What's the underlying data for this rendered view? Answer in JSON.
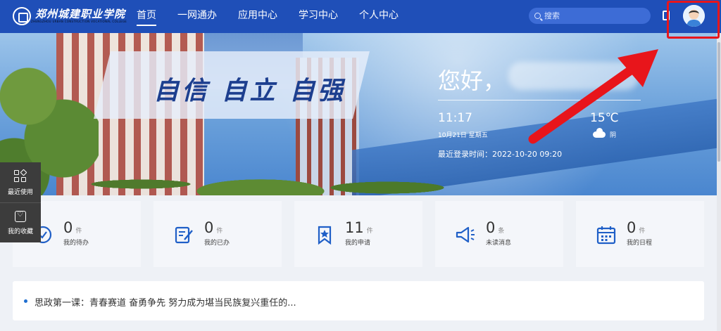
{
  "header": {
    "logo_text": "郑州城建职业学院",
    "logo_sub": "ZHENGZHOU URBAN CONSTRUCTION VOCATIONAL COLLEGE",
    "nav": [
      {
        "label": "首页",
        "active": true
      },
      {
        "label": "一网通办",
        "active": false
      },
      {
        "label": "应用中心",
        "active": false
      },
      {
        "label": "学习中心",
        "active": false
      },
      {
        "label": "个人中心",
        "active": false
      }
    ],
    "search_placeholder": "搜索"
  },
  "hero": {
    "slogan": "自信 自立 自强",
    "greeting": "您好，",
    "time": "11:17",
    "date": "10月21日 星期五",
    "temperature": "15℃",
    "weather": "阴",
    "last_login": "最近登录时间：2022-10-20 09:20"
  },
  "float_sidebar": {
    "recent": "最近使用",
    "favorites": "我的收藏"
  },
  "stats": [
    {
      "num": "0",
      "unit": "件",
      "label": "我的待办",
      "icon": "clock-check-icon"
    },
    {
      "num": "0",
      "unit": "件",
      "label": "我的已办",
      "icon": "edit-doc-icon"
    },
    {
      "num": "11",
      "unit": "件",
      "label": "我的申请",
      "icon": "bookmark-star-icon"
    },
    {
      "num": "0",
      "unit": "条",
      "label": "未读消息",
      "icon": "megaphone-icon"
    },
    {
      "num": "0",
      "unit": "件",
      "label": "我的日程",
      "icon": "calendar-icon"
    }
  ],
  "news": {
    "item": "思政第一课：青春赛道 奋勇争先 努力成为堪当民族复兴重任的..."
  },
  "colors": {
    "brand": "#1f4fb8",
    "accent_icon": "#1f5fc7",
    "annotation": "#e8151b"
  }
}
